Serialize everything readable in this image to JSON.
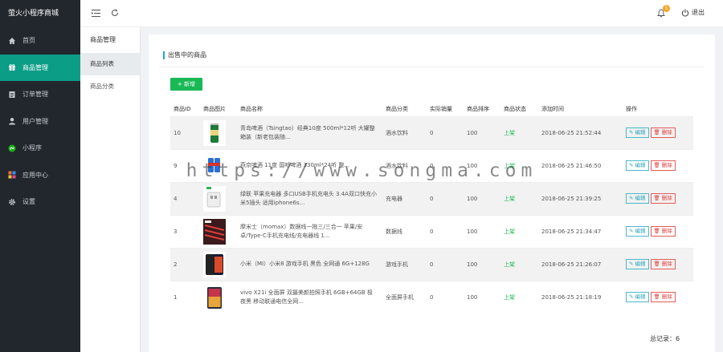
{
  "sidebar": {
    "brand": "萤火小程序商城",
    "items": [
      {
        "label": "首页",
        "icon": "home-icon"
      },
      {
        "label": "商品管理",
        "icon": "gift-icon",
        "active": true
      },
      {
        "label": "订单管理",
        "icon": "order-icon"
      },
      {
        "label": "用户管理",
        "icon": "user-icon"
      },
      {
        "label": "小程序",
        "icon": "miniprogram-icon"
      },
      {
        "label": "应用中心",
        "icon": "apps-icon"
      },
      {
        "label": "设置",
        "icon": "gear-icon"
      }
    ]
  },
  "subnav": {
    "title": "商品管理",
    "items": [
      {
        "label": "商品列表",
        "active": true
      },
      {
        "label": "商品分类"
      }
    ]
  },
  "topbar": {
    "notification_count": "5",
    "logout_label": "退出"
  },
  "panel": {
    "title": "出售中的商品",
    "add_label": "新增",
    "total_label": "总记录：6"
  },
  "table": {
    "headers": [
      "商品ID",
      "商品图片",
      "商品名称",
      "商品分类",
      "实际销量",
      "商品排序",
      "商品状态",
      "添加时间",
      "操作"
    ],
    "edit_label": "编辑",
    "delete_label": "删除",
    "rows": [
      {
        "id": "10",
        "name": "青岛啤酒（Tsingtao）经典10度 500ml*12听 大罐整箱装（新老包装随...",
        "category": "酒水饮料",
        "sales": "0",
        "sort": "100",
        "status": "上架",
        "time": "2018-06-25 21:52:44",
        "thumb": "beer-can"
      },
      {
        "id": "9",
        "name": "燕京啤酒 11度 国听啤酒 330ml*24听 整...",
        "category": "酒水饮料",
        "sales": "0",
        "sort": "100",
        "status": "上架",
        "time": "2018-06-25 21:46:50",
        "thumb": "beer-cans"
      },
      {
        "id": "4",
        "name": "绿联 苹果充电器 多口USB手机充电头 3.4A双口快充小米5插头 适用iphone6s...",
        "category": "充电器",
        "sales": "0",
        "sort": "100",
        "status": "上架",
        "time": "2018-06-25 21:39:25",
        "thumb": "charger"
      },
      {
        "id": "3",
        "name": "摩米士（momax）数据线一拖三/三合一 苹果/安卓/Type-C手机充电线/充电器线 1...",
        "category": "数据线",
        "sales": "0",
        "sort": "100",
        "status": "上架",
        "time": "2018-06-25 21:34:47",
        "thumb": "cable"
      },
      {
        "id": "2",
        "name": "小米（MI）小米8 游戏手机 黑色 全网通 6G+128G",
        "category": "游戏手机",
        "sales": "0",
        "sort": "100",
        "status": "上架",
        "time": "2018-06-25 21:26:07",
        "thumb": "phone-dark"
      },
      {
        "id": "1",
        "name": "vivo X21i 全面屏 双摄美颜拍照手机 6GB+64GB 极夜黑 移动联通电信全网...",
        "category": "全面屏手机",
        "sales": "0",
        "sort": "100",
        "status": "上架",
        "time": "2018-06-25 21:18:19",
        "thumb": "phone-color"
      }
    ]
  },
  "watermark": "https://www.songma.com"
}
